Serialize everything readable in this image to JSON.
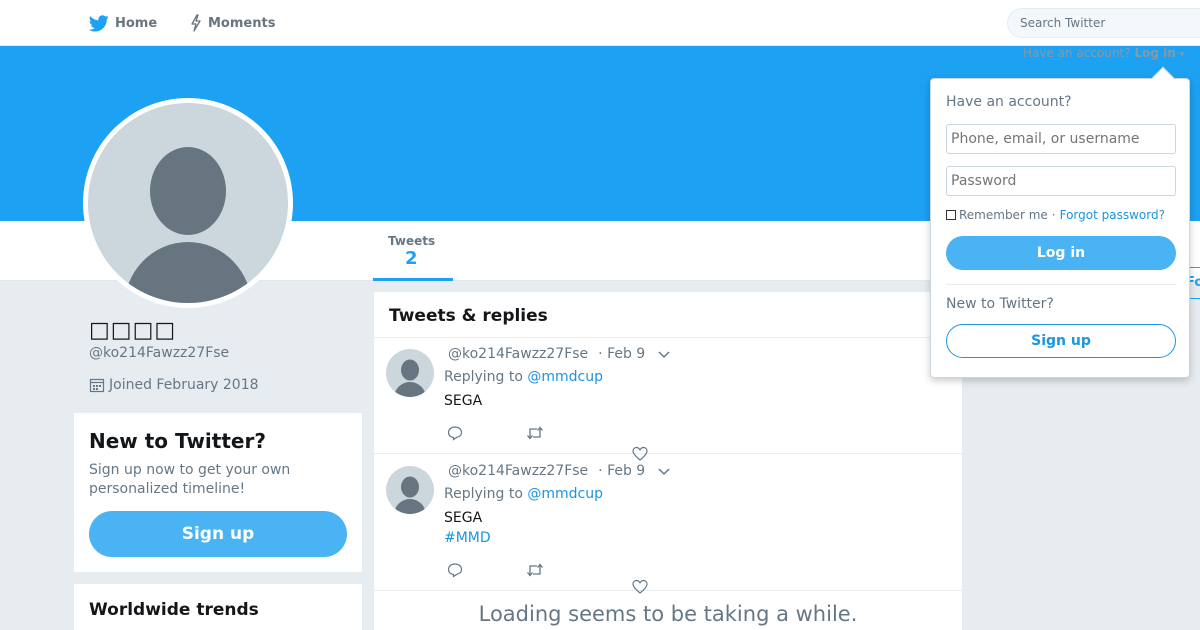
{
  "nav": {
    "home_label": "Home",
    "moments_label": "Moments",
    "search_placeholder": "Search Twitter"
  },
  "banner": {
    "have_account_text": "Have an account?",
    "login_link": "Log in"
  },
  "profile": {
    "display_name": "□□□□",
    "handle": "@ko214Fawzz27Fse",
    "joined": "Joined February 2018",
    "tweets_label": "Tweets",
    "tweets_count": "2",
    "follow_label": "Fo"
  },
  "sidebar": {
    "new_title": "New to Twitter?",
    "new_desc": "Sign up now to get your own personalized timeline!",
    "signup_label": "Sign up",
    "trends_title": "Worldwide trends"
  },
  "timeline": {
    "title": "Tweets & replies",
    "tweets": [
      {
        "handle": "@ko214Fawzz27Fse",
        "date": "· Feb 9",
        "replying_prefix": "Replying to",
        "replying_to": "@mmdcup",
        "text": "SEGA",
        "hashtag": ""
      },
      {
        "handle": "@ko214Fawzz27Fse",
        "date": "· Feb 9",
        "replying_prefix": "Replying to",
        "replying_to": "@mmdcup",
        "text": "SEGA",
        "hashtag": "#MMD"
      }
    ],
    "loading_text": "Loading seems to be taking a while."
  },
  "login_dropdown": {
    "title": "Have an account?",
    "username_placeholder": "Phone, email, or username",
    "password_placeholder": "Password",
    "remember_label": "Remember me",
    "separator": "·",
    "forgot_label": "Forgot password?",
    "login_button": "Log in",
    "new_text": "New to Twitter?",
    "signup_button": "Sign up"
  },
  "colors": {
    "brand_blue": "#1da1f2",
    "button_blue": "#4ab3f4",
    "link_blue": "#1b95e0"
  }
}
